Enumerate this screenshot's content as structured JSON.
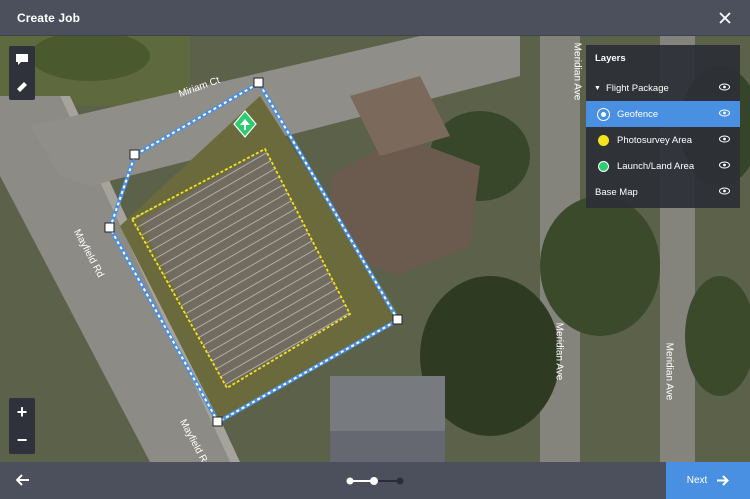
{
  "header": {
    "title": "Create Job"
  },
  "map": {
    "street_labels": [
      "Miriam Ct",
      "Mayfield Rd",
      "Mayfield Rd",
      "Meridian Ave",
      "Meridian Ave",
      "Meridian Ave"
    ],
    "tools": [
      "comment-tool",
      "ruler-tool"
    ],
    "zoom": {
      "in": "+",
      "out": "−"
    }
  },
  "layers": {
    "title": "Layers",
    "group": "Flight Package",
    "items": [
      {
        "label": "Geofence",
        "color": "#4a90e2",
        "active": true
      },
      {
        "label": "Photosurvey Area",
        "color": "#f5e31f",
        "active": false
      },
      {
        "label": "Launch/Land Area",
        "color": "#2ecc71",
        "active": false
      }
    ],
    "base": "Base Map"
  },
  "footer": {
    "next_label": "Next",
    "steps_total": 3,
    "step_current": 2
  },
  "colors": {
    "accent": "#4a90e2",
    "bar": "#4b505c",
    "geofence": "#ffffff",
    "photosurvey": "#f5e31f"
  }
}
